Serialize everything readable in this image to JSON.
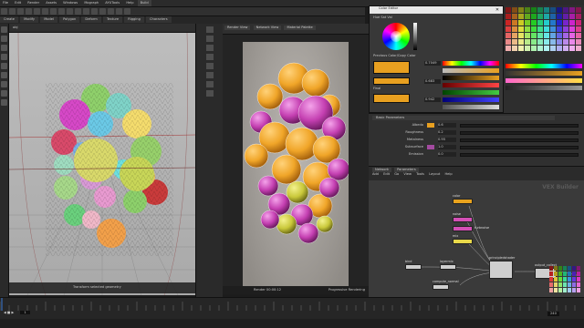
{
  "menubar": {
    "items": [
      "File",
      "Edit",
      "Render",
      "Assets",
      "Windows",
      "Mograph",
      "AYUTools",
      "Help",
      "Build"
    ],
    "workspace": "Build"
  },
  "shelf_tabs": [
    "Create",
    "Modify",
    "Model",
    "Polygon",
    "Deform",
    "Texture",
    "Rigging",
    "Characters",
    "Constraints",
    "Guide Process",
    "Terrain FX"
  ],
  "viewport": {
    "title": "obj",
    "status": "Transform selected geometry"
  },
  "renderview": {
    "tabs": [
      "Render View",
      "Network View",
      "Material Palette"
    ],
    "footer_left": "Render 00:00:12",
    "footer_right": "Progressive Rendering"
  },
  "color_editor": {
    "title": "Color Editor",
    "labels": [
      "Hue",
      "Sat",
      "Val"
    ],
    "hsv_values": [
      "0.7049",
      "0.683",
      "0.942"
    ],
    "previous_label": "Previous Color/Copy Color",
    "new_label": "Final",
    "swatch_color": "#e8a020"
  },
  "params": {
    "section": "Basic Parameters",
    "rows": [
      "Albedo",
      "Roughness",
      "Metalness",
      "Subsurface",
      "Emission"
    ],
    "values": [
      "0.6",
      "0.2",
      "0.95",
      "1.0",
      "0.0"
    ],
    "colors": [
      "#e8a020",
      "#ffffff",
      "#ffffff",
      "#a34aa0",
      "#000000"
    ]
  },
  "network": {
    "tabs": [
      "Network",
      "Parameters"
    ],
    "menu": [
      "Add",
      "Edit",
      "Go",
      "View",
      "Tools",
      "Layout",
      "Help"
    ],
    "watermark": "VEX Builder",
    "nodes": [
      {
        "label": "color",
        "color": "#e9a31d"
      },
      {
        "label": "noise",
        "color": "#d44fb6"
      },
      {
        "label": "turbnoise",
        "color": "#d44fb6"
      },
      {
        "label": "mix",
        "color": "#e9d94a"
      },
      {
        "label": "bind",
        "color": "#e9d94a"
      },
      {
        "label": "principledshader",
        "color": "#cfcfcf"
      },
      {
        "label": "output_collect",
        "color": "#cfcfcf"
      },
      {
        "label": "layermix",
        "color": "#cfcfcf"
      },
      {
        "label": "compute_normal",
        "color": "#cfcfcf"
      },
      {
        "label": "mtlxstandard",
        "color": "#cfcfcf"
      }
    ]
  },
  "timeline": {
    "frame": "1",
    "start": "1",
    "end": "240"
  },
  "colors": {
    "orange_ball": "#f0a528",
    "magenta_ball": "#c43fb1",
    "yellow_ball": "#c9c83a",
    "viewport_bg": "#b6b6b6"
  }
}
